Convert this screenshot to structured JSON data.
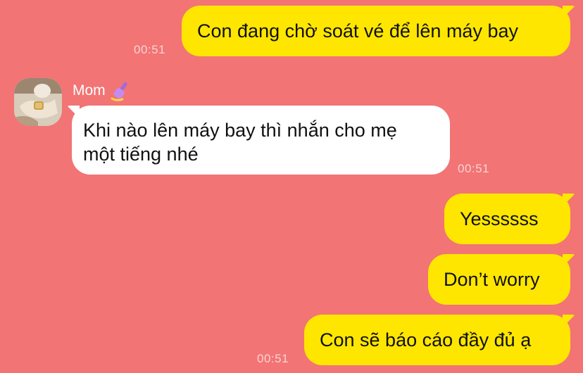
{
  "contact": {
    "name": "Mom",
    "name_icon": "nail-polish-icon"
  },
  "messages": [
    {
      "from": "me",
      "text": "Con đang chờ soát vé để lên máy bay",
      "time": "00:51"
    },
    {
      "from": "mom",
      "text_lines": [
        "Khi nào lên máy bay thì nhắn cho mẹ",
        "một tiếng nhé"
      ],
      "time": "00:51"
    },
    {
      "from": "me",
      "text": "Yessssss"
    },
    {
      "from": "me",
      "text": "Don’t worry"
    },
    {
      "from": "me",
      "text": "Con sẽ báo cáo đầy đủ ạ",
      "time": "00:51"
    }
  ],
  "colors": {
    "background": "#f27474",
    "outgoing_bubble": "#ffe600",
    "incoming_bubble": "#ffffff"
  }
}
